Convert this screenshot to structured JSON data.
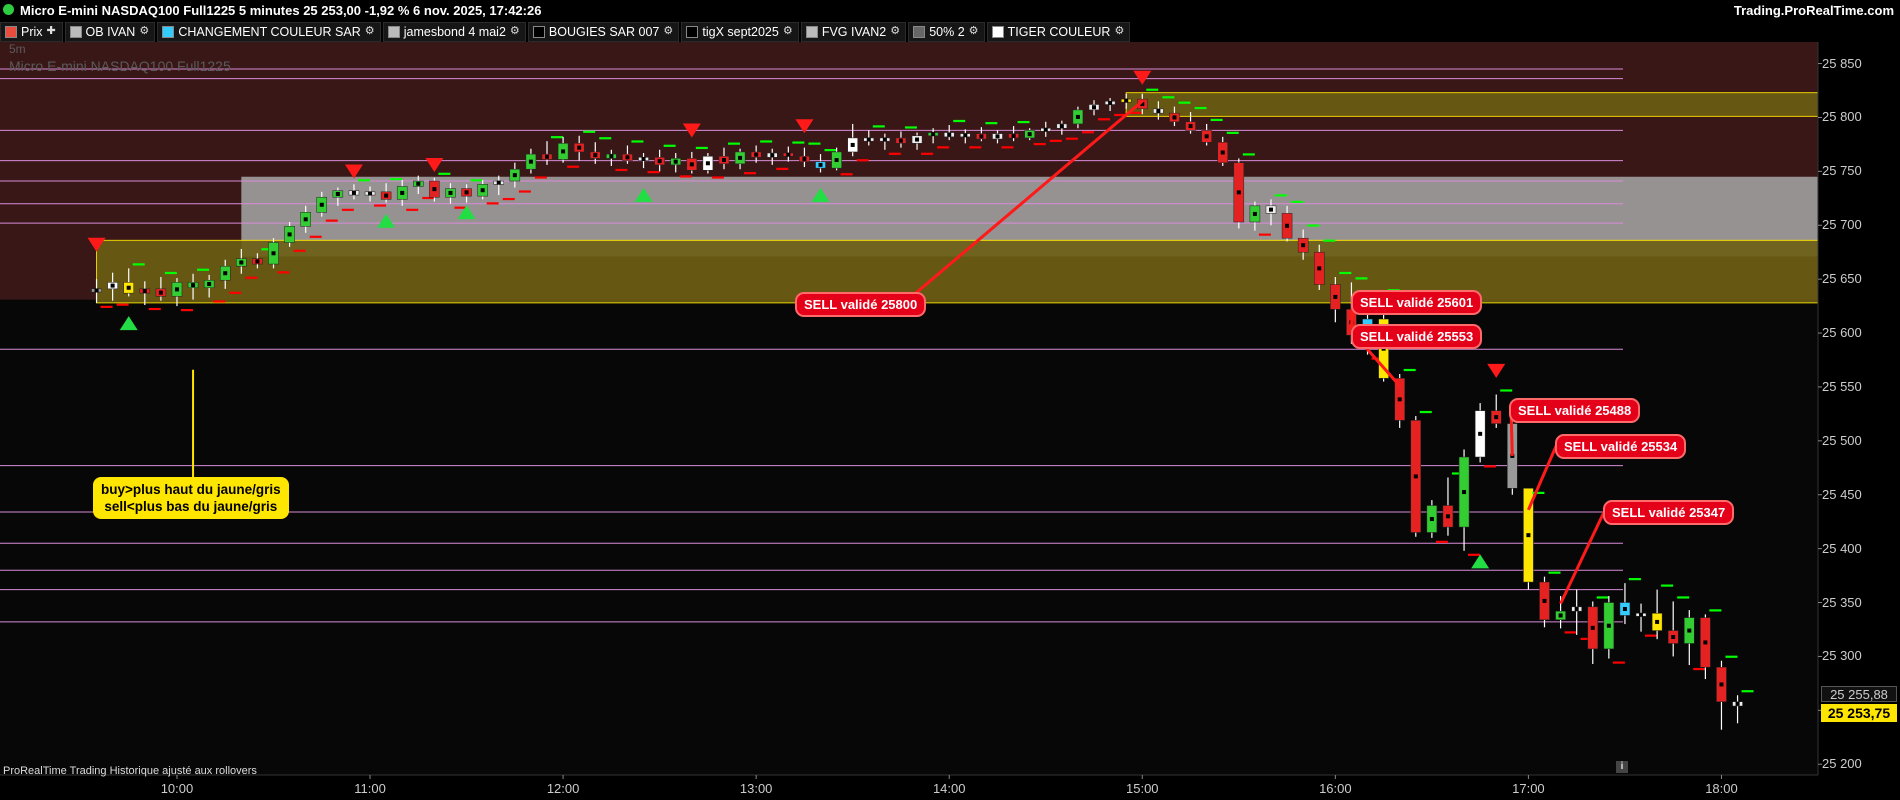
{
  "titlebar": {
    "title": "Micro E-mini NASDAQ100 Full1225 5 minutes 25 253,00 -1,92 % 6 nov. 2025, 17:42:26",
    "site": "Trading.ProRealTime.com"
  },
  "legend": [
    {
      "label": "Prix",
      "color": "#e74c3c",
      "icon": "plus-icon"
    },
    {
      "label": "OB IVAN",
      "color": "#bbbbbb",
      "icon": "wrench-icon"
    },
    {
      "label": "CHANGEMENT COULEUR SAR",
      "color": "#33ccff",
      "icon": "wrench-icon"
    },
    {
      "label": "jamesbond 4 mai2",
      "color": "#bbbbbb",
      "icon": "wrench-icon"
    },
    {
      "label": "BOUGIES SAR 007",
      "color": "#000000",
      "icon": "wrench-icon"
    },
    {
      "label": "tigX sept2025",
      "color": "#000000",
      "icon": "wrench-icon"
    },
    {
      "label": "FVG IVAN2",
      "color": "#bbbbbb",
      "icon": "wrench-icon"
    },
    {
      "label": "50% 2",
      "color": "#666666",
      "icon": "wrench-icon"
    },
    {
      "label": "TIGER COULEUR",
      "color": "#ffffff",
      "icon": "wrench-icon"
    }
  ],
  "timeframe": "5m",
  "watermark": "Micro E-mini NASDAQ100 Full1225",
  "footer": "ProRealTime Trading  Historique ajusté aux rollovers",
  "annotations": [
    "SELL validé 25800",
    "SELL validé 25601",
    "SELL validé 25553",
    "SELL validé 25488",
    "SELL validé 25534",
    "SELL validé 25347"
  ],
  "note": {
    "line1": "buy>plus haut du jaune/gris",
    "line2": "sell<plus bas du jaune/gris"
  },
  "price_labels": {
    "mid": "25 255,88",
    "last": "25 253,75"
  },
  "colors": {
    "up": "#33cc33",
    "down": "#e52222",
    "neutral": "#eeeeee",
    "yellow": "#ffe600",
    "cyan": "#33ccff",
    "gray": "#999999",
    "sar_green": "#00ff00",
    "sar_red": "#ff0000",
    "hline": "#d98bd9"
  },
  "chart_data": {
    "type": "candlestick",
    "title": "Micro E-mini NASDAQ100 Full1225",
    "timeframe_minutes": 5,
    "y_ticks": [
      "25 850",
      "25 800",
      "25 750",
      "25 700",
      "25 650",
      "25 600",
      "25 550",
      "25 500",
      "25 450",
      "25 400",
      "25 350",
      "25 300",
      "25 250",
      "25 200"
    ],
    "x_ticks": [
      "10:00",
      "11:00",
      "12:00",
      "13:00",
      "14:00",
      "15:00",
      "16:00",
      "17:00",
      "18:00"
    ],
    "ylim": [
      25190,
      25870
    ],
    "zones": [
      {
        "kind": "resistance",
        "from": 25631,
        "to": 25870,
        "color": "#4a1d1d"
      },
      {
        "kind": "order-block",
        "from": 25671,
        "to": 25745,
        "color": "#bdbdbd"
      },
      {
        "kind": "fvg",
        "from": 25628,
        "to": 25686,
        "color": "#7a6a18"
      },
      {
        "kind": "fvg",
        "from": 25801,
        "to": 25823,
        "color": "#7a6a18"
      }
    ],
    "horizontal_levels": [
      25845,
      25836,
      25788,
      25760,
      25741,
      25720,
      25702,
      25585,
      25477,
      25434,
      25405,
      25380,
      25362,
      25332
    ],
    "candles": [
      [
        "09:35",
        25638,
        25650,
        25628,
        25641,
        "gray"
      ],
      [
        "09:40",
        25641,
        25656,
        25630,
        25647,
        "white"
      ],
      [
        "09:45",
        25647,
        25660,
        25634,
        25637,
        "yellow"
      ],
      [
        "09:50",
        25637,
        25648,
        25626,
        25641,
        "down"
      ],
      [
        "09:55",
        25641,
        25652,
        25630,
        25634,
        "down"
      ],
      [
        "10:00",
        25634,
        25651,
        25625,
        25647,
        "up"
      ],
      [
        "10:05",
        25647,
        25655,
        25631,
        25642,
        "up"
      ],
      [
        "10:10",
        25642,
        25654,
        25633,
        25649,
        "up"
      ],
      [
        "10:15",
        25649,
        25668,
        25641,
        25662,
        "up"
      ],
      [
        "10:20",
        25662,
        25678,
        25655,
        25669,
        "up"
      ],
      [
        "10:25",
        25669,
        25674,
        25660,
        25664,
        "down"
      ],
      [
        "10:30",
        25664,
        25688,
        25660,
        25684,
        "up"
      ],
      [
        "10:35",
        25684,
        25703,
        25680,
        25699,
        "up"
      ],
      [
        "10:40",
        25699,
        25718,
        25693,
        25712,
        "up"
      ],
      [
        "10:45",
        25712,
        25731,
        25708,
        25726,
        "up"
      ],
      [
        "10:50",
        25726,
        25735,
        25718,
        25732,
        "up"
      ],
      [
        "10:55",
        25732,
        25738,
        25724,
        25728,
        "neutral"
      ],
      [
        "11:00",
        25728,
        25736,
        25722,
        25731,
        "neutral"
      ],
      [
        "11:05",
        25731,
        25739,
        25721,
        25724,
        "down"
      ],
      [
        "11:10",
        25724,
        25742,
        25718,
        25736,
        "up"
      ],
      [
        "11:15",
        25736,
        25746,
        25729,
        25741,
        "up"
      ],
      [
        "11:20",
        25741,
        25744,
        25722,
        25726,
        "down"
      ],
      [
        "11:25",
        25726,
        25739,
        25720,
        25734,
        "up"
      ],
      [
        "11:30",
        25734,
        25738,
        25721,
        25727,
        "down"
      ],
      [
        "11:35",
        25727,
        25742,
        25724,
        25738,
        "up"
      ],
      [
        "11:40",
        25738,
        25746,
        25728,
        25741,
        "neutral"
      ],
      [
        "11:45",
        25741,
        25758,
        25735,
        25752,
        "up"
      ],
      [
        "11:50",
        25752,
        25771,
        25748,
        25766,
        "up"
      ],
      [
        "11:55",
        25766,
        25778,
        25756,
        25761,
        "down"
      ],
      [
        "12:00",
        25761,
        25782,
        25758,
        25776,
        "up"
      ],
      [
        "12:05",
        25776,
        25783,
        25760,
        25768,
        "down"
      ],
      [
        "12:10",
        25768,
        25777,
        25757,
        25762,
        "down"
      ],
      [
        "12:15",
        25762,
        25770,
        25755,
        25766,
        "up"
      ],
      [
        "12:20",
        25766,
        25774,
        25757,
        25760,
        "down"
      ],
      [
        "12:25",
        25760,
        25767,
        25753,
        25763,
        "neutral"
      ],
      [
        "12:30",
        25763,
        25770,
        25750,
        25756,
        "down"
      ],
      [
        "12:35",
        25756,
        25767,
        25749,
        25762,
        "up"
      ],
      [
        "12:40",
        25762,
        25768,
        25748,
        25751,
        "down"
      ],
      [
        "12:45",
        25751,
        25767,
        25748,
        25764,
        "white"
      ],
      [
        "12:50",
        25764,
        25772,
        25752,
        25757,
        "down"
      ],
      [
        "12:55",
        25757,
        25771,
        25752,
        25768,
        "up"
      ],
      [
        "13:00",
        25768,
        25774,
        25758,
        25763,
        "down"
      ],
      [
        "13:05",
        25763,
        25771,
        25756,
        25767,
        "neutral"
      ],
      [
        "13:10",
        25767,
        25773,
        25759,
        25764,
        "down"
      ],
      [
        "13:15",
        25764,
        25772,
        25754,
        25759,
        "down"
      ],
      [
        "13:20",
        25759,
        25766,
        25749,
        25753,
        "cyan"
      ],
      [
        "13:25",
        25753,
        25772,
        25751,
        25768,
        "up"
      ],
      [
        "13:30",
        25768,
        25794,
        25764,
        25781,
        "white"
      ],
      [
        "13:35",
        25781,
        25788,
        25774,
        25778,
        "neutral"
      ],
      [
        "13:40",
        25778,
        25785,
        25770,
        25781,
        "neutral"
      ],
      [
        "13:45",
        25781,
        25787,
        25772,
        25776,
        "down"
      ],
      [
        "13:50",
        25776,
        25786,
        25770,
        25783,
        "neutral"
      ],
      [
        "13:55",
        25783,
        25790,
        25776,
        25786,
        "up"
      ],
      [
        "14:00",
        25786,
        25793,
        25779,
        25782,
        "neutral"
      ],
      [
        "14:05",
        25782,
        25789,
        25776,
        25785,
        "neutral"
      ],
      [
        "14:10",
        25785,
        25791,
        25778,
        25780,
        "down"
      ],
      [
        "14:15",
        25780,
        25788,
        25776,
        25785,
        "neutral"
      ],
      [
        "14:20",
        25785,
        25792,
        25778,
        25781,
        "down"
      ],
      [
        "14:25",
        25781,
        25790,
        25779,
        25788,
        "up"
      ],
      [
        "14:30",
        25788,
        25796,
        25782,
        25790,
        "neutral"
      ],
      [
        "14:35",
        25790,
        25797,
        25784,
        25794,
        "neutral"
      ],
      [
        "14:40",
        25794,
        25810,
        25790,
        25807,
        "up"
      ],
      [
        "14:45",
        25807,
        25816,
        25802,
        25812,
        "neutral"
      ],
      [
        "14:50",
        25812,
        25818,
        25806,
        25815,
        "neutral"
      ],
      [
        "14:55",
        25815,
        25822,
        25808,
        25817,
        "yellow"
      ],
      [
        "15:00",
        25817,
        25822,
        25803,
        25808,
        "down"
      ],
      [
        "15:05",
        25808,
        25815,
        25798,
        25804,
        "neutral"
      ],
      [
        "15:10",
        25804,
        25810,
        25792,
        25796,
        "down"
      ],
      [
        "15:15",
        25796,
        25805,
        25785,
        25788,
        "down"
      ],
      [
        "15:20",
        25788,
        25794,
        25774,
        25777,
        "down"
      ],
      [
        "15:25",
        25777,
        25782,
        25755,
        25758,
        "down"
      ],
      [
        "15:30",
        25758,
        25762,
        25697,
        25703,
        "down"
      ],
      [
        "15:35",
        25703,
        25722,
        25695,
        25718,
        "up"
      ],
      [
        "15:40",
        25718,
        25724,
        25700,
        25711,
        "neutral"
      ],
      [
        "15:45",
        25711,
        25718,
        25685,
        25688,
        "down"
      ],
      [
        "15:50",
        25688,
        25696,
        25668,
        25675,
        "down"
      ],
      [
        "15:55",
        25675,
        25682,
        25640,
        25645,
        "down"
      ],
      [
        "16:00",
        25645,
        25652,
        25610,
        25622,
        "down"
      ],
      [
        "16:05",
        25622,
        25647,
        25590,
        25598,
        "down"
      ],
      [
        "16:10",
        25598,
        25621,
        25580,
        25613,
        "cyan"
      ],
      [
        "16:15",
        25613,
        25636,
        25555,
        25558,
        "yellow"
      ],
      [
        "16:20",
        25558,
        25562,
        25512,
        25519,
        "down"
      ],
      [
        "16:25",
        25519,
        25523,
        25411,
        25415,
        "down"
      ],
      [
        "16:30",
        25415,
        25445,
        25410,
        25440,
        "up"
      ],
      [
        "16:35",
        25440,
        25466,
        25412,
        25420,
        "down"
      ],
      [
        "16:40",
        25420,
        25492,
        25398,
        25485,
        "up"
      ],
      [
        "16:45",
        25485,
        25535,
        25480,
        25528,
        "white"
      ],
      [
        "16:50",
        25528,
        25543,
        25512,
        25516,
        "down"
      ],
      [
        "16:55",
        25516,
        25522,
        25450,
        25456,
        "gray"
      ],
      [
        "17:00",
        25456,
        25448,
        25362,
        25369,
        "yellow"
      ],
      [
        "17:05",
        25369,
        25374,
        25327,
        25334,
        "down"
      ],
      [
        "17:10",
        25334,
        25356,
        25326,
        25342,
        "up"
      ],
      [
        "17:15",
        25342,
        25362,
        25320,
        25346,
        "neutral"
      ],
      [
        "17:20",
        25346,
        25351,
        25293,
        25307,
        "down"
      ],
      [
        "17:25",
        25307,
        25356,
        25298,
        25350,
        "up"
      ],
      [
        "17:30",
        25350,
        25368,
        25330,
        25338,
        "cyan"
      ],
      [
        "17:35",
        25338,
        25349,
        25323,
        25340,
        "neutral"
      ],
      [
        "17:40",
        25340,
        25362,
        25316,
        25324,
        "yellow"
      ],
      [
        "17:45",
        25324,
        25351,
        25300,
        25312,
        "down"
      ],
      [
        "17:50",
        25312,
        25343,
        25292,
        25336,
        "up"
      ],
      [
        "17:55",
        25336,
        25339,
        25279,
        25290,
        "down"
      ],
      [
        "18:00",
        25290,
        25296,
        25232,
        25258,
        "down"
      ],
      [
        "18:05",
        25258,
        25264,
        25238,
        25254,
        "neutral"
      ]
    ]
  }
}
